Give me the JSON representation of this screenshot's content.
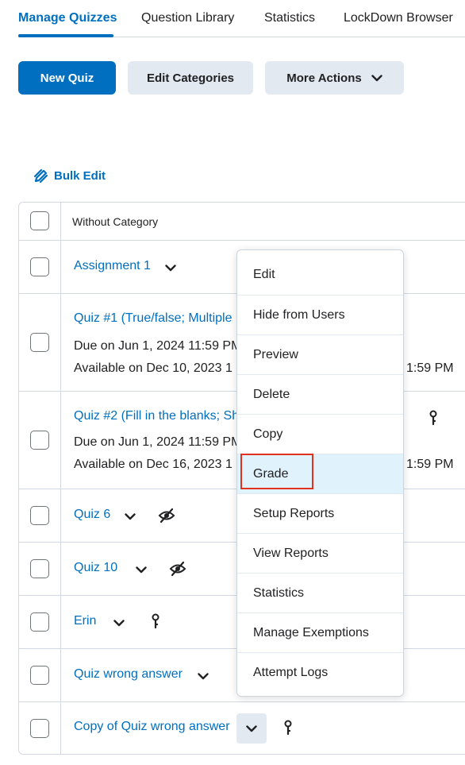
{
  "tabs": [
    {
      "label": "Manage Quizzes",
      "active": true
    },
    {
      "label": "Question Library"
    },
    {
      "label": "Statistics"
    },
    {
      "label": "LockDown Browser"
    }
  ],
  "actions": {
    "new_quiz": "New Quiz",
    "edit_categories": "Edit Categories",
    "more_actions": "More Actions"
  },
  "bulk_edit": "Bulk Edit",
  "table": {
    "category_header": "Without Category",
    "rows": [
      {
        "title": "Assignment 1"
      },
      {
        "title": "Quiz #1 (True/false; Multiple",
        "due": "Due on Jun 1, 2024 11:59 PM",
        "available": "Available on Dec 10, 2023 1",
        "available_end": "1:59 PM"
      },
      {
        "title": "Quiz #2 (Fill in the blanks; Sh",
        "due": "Due on Jun 1, 2024 11:59 PM",
        "available": "Available on Dec 16, 2023 1",
        "available_end": "1:59 PM",
        "icon": "key-icon"
      },
      {
        "title": "Quiz 6",
        "icon": "hidden-eye-icon"
      },
      {
        "title": "Quiz 10",
        "icon": "hidden-eye-icon"
      },
      {
        "title": "Erin",
        "icon": "key-icon"
      },
      {
        "title": "Quiz wrong answer"
      },
      {
        "title": "Copy of Quiz wrong answer",
        "icon": "key-icon"
      }
    ]
  },
  "context_menu": {
    "items": [
      "Edit",
      "Hide from Users",
      "Preview",
      "Delete",
      "Copy",
      "Grade",
      "Setup Reports",
      "View Reports",
      "Statistics",
      "Manage Exemptions",
      "Attempt Logs"
    ],
    "selected": "Grade"
  },
  "colors": {
    "accent": "#006fbf",
    "secondary_button": "#e3e9f1",
    "menu_selected": "#e0f2fb",
    "highlight_border": "#e0321f"
  }
}
